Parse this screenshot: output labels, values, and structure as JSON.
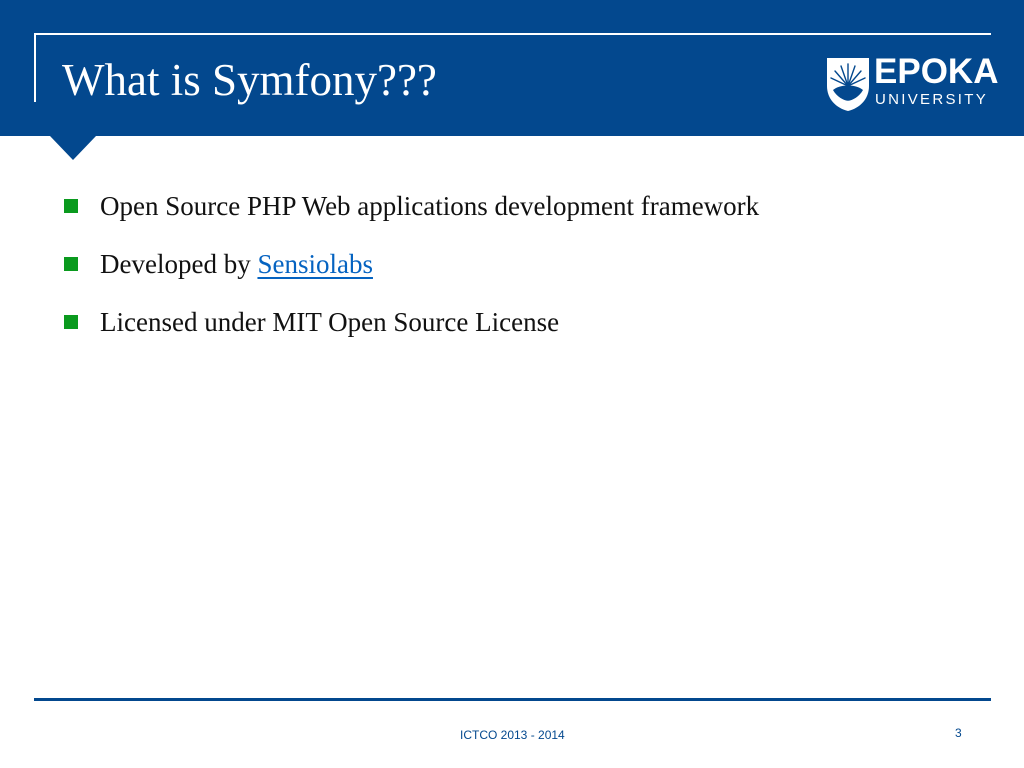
{
  "slide": {
    "title": "What is Symfony???",
    "logo": {
      "name_main": "EPOKA",
      "name_sub": "UNIVERSITY",
      "mark_icon": "sunburst-shield-icon"
    },
    "bullets": [
      {
        "text": "Open Source PHP Web applications development framework"
      },
      {
        "text": "Developed by ",
        "link_text": "Sensiolabs"
      },
      {
        "text": "Licensed under MIT Open Source License"
      }
    ],
    "footer": {
      "text": "ICTCO 2013 - 2014",
      "page_number": "3"
    }
  },
  "colors": {
    "header_blue": "#03488e",
    "bullet_green": "#0a9a1e",
    "link_blue": "#0563c1",
    "text_dark": "#111111"
  }
}
